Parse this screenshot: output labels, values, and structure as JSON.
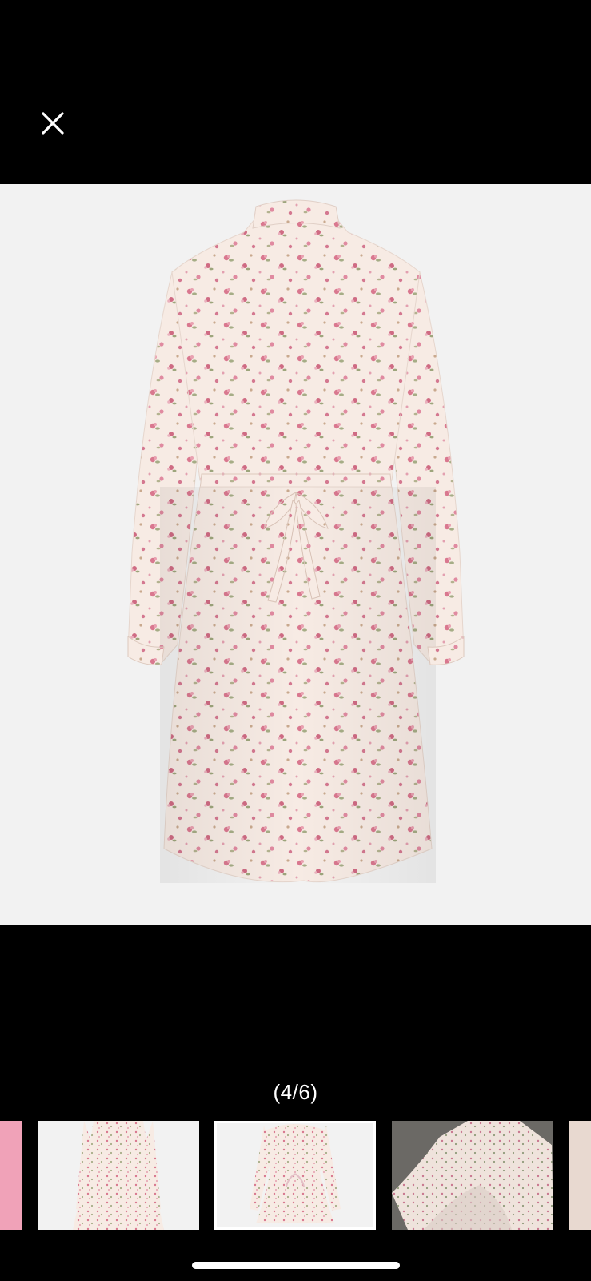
{
  "viewer": {
    "close_icon": "close-icon",
    "counter_text": "(4/6)",
    "current_index": 4,
    "total": 6
  },
  "colors": {
    "background": "#000000",
    "image_background": "#f2f2f2",
    "fabric": "#f7ebe4",
    "flower_pink": "#d9788f",
    "leaf": "#a6ad86",
    "thumb_pink": "#f0a2b8"
  },
  "thumbnails": [
    {
      "name": "thumb-1-pink",
      "active": false
    },
    {
      "name": "thumb-2-dress-front",
      "active": false
    },
    {
      "name": "thumb-3-dress-back",
      "active": true
    },
    {
      "name": "thumb-4-dress-photo",
      "active": false
    },
    {
      "name": "thumb-5-partial",
      "active": false
    }
  ]
}
